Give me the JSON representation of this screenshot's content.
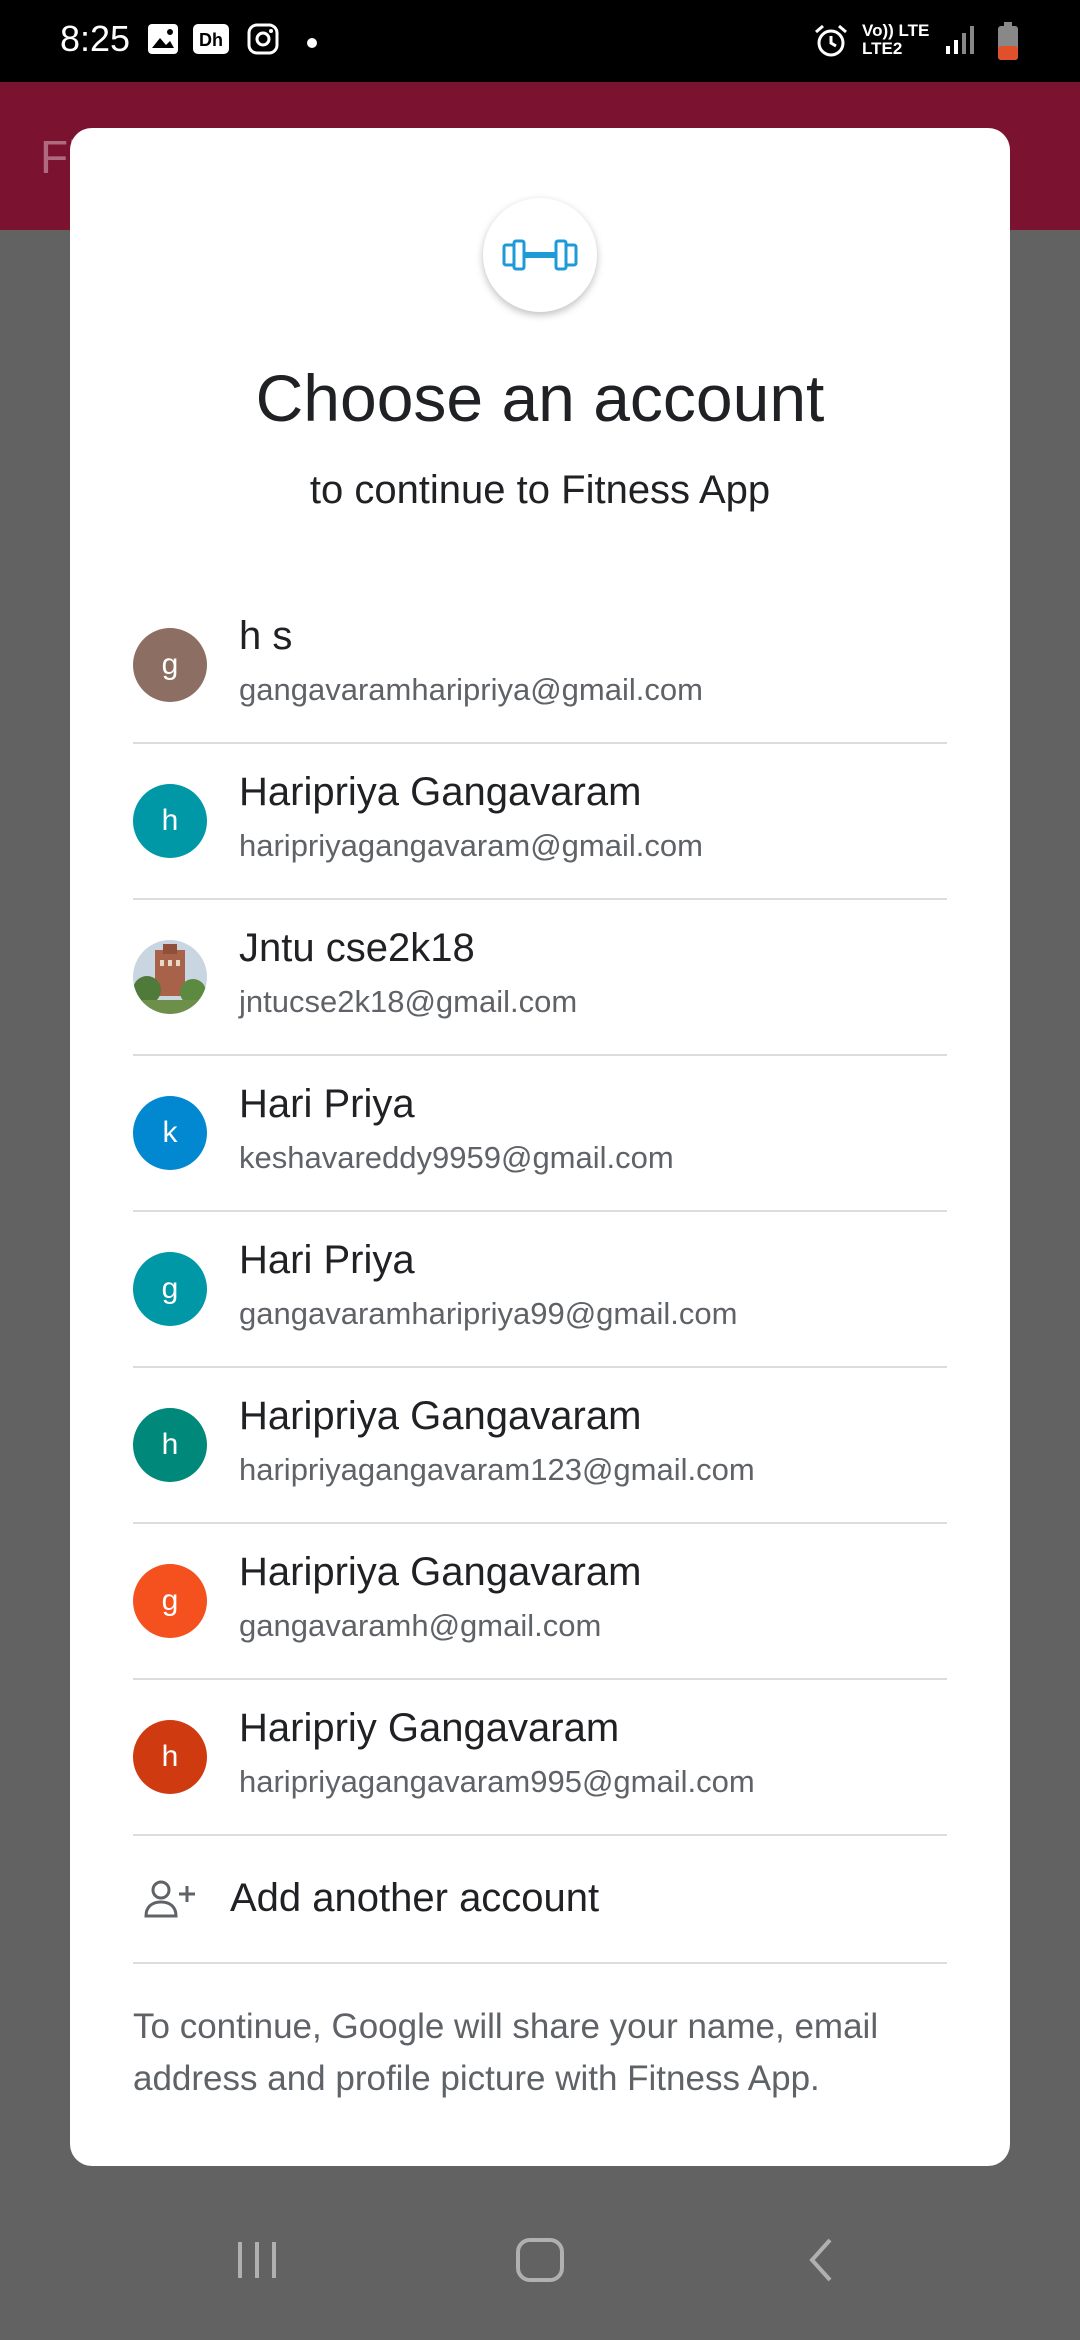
{
  "status_bar": {
    "time": "8:25",
    "icons": [
      "gallery-icon",
      "dh-app-icon",
      "instagram-icon",
      "dot-icon",
      "alarm-icon",
      "volte-lte-icon",
      "signal-icon",
      "battery-icon"
    ],
    "network_top": "Vo)) LTE",
    "network_bottom": "LTE2"
  },
  "app_bar": {
    "title_partial": "Fi"
  },
  "dialog": {
    "title": "Choose an account",
    "subtitle": "to continue to Fitness App",
    "accounts": [
      {
        "initial": "g",
        "name": "h s",
        "email": "gangavaramharipriya@gmail.com",
        "color": "#8d6e63"
      },
      {
        "initial": "h",
        "name": "Haripriya Gangavaram",
        "email": "haripriyagangavaram@gmail.com",
        "color": "#0097a7"
      },
      {
        "initial": "",
        "name": "Jntu cse2k18",
        "email": "jntucse2k18@gmail.com",
        "color": "#8a6f5e"
      },
      {
        "initial": "k",
        "name": "Hari Priya",
        "email": "keshavareddy9959@gmail.com",
        "color": "#0288d1"
      },
      {
        "initial": "g",
        "name": "Hari Priya",
        "email": "gangavaramharipriya99@gmail.com",
        "color": "#0097a7"
      },
      {
        "initial": "h",
        "name": "Haripriya Gangavaram",
        "email": "haripriyagangavaram123@gmail.com",
        "color": "#00897b"
      },
      {
        "initial": "g",
        "name": "Haripriya Gangavaram",
        "email": "gangavaramh@gmail.com",
        "color": "#f4511e"
      },
      {
        "initial": "h",
        "name": "Haripriy Gangavaram",
        "email": "haripriyagangavaram995@gmail.com",
        "color": "#d03a10"
      }
    ],
    "add_account_label": "Add another account",
    "footer_note": "To continue, Google will share your name, email address and profile picture with Fitness App."
  },
  "nav_bar": {
    "buttons": [
      "recents-button",
      "home-button",
      "back-button"
    ]
  }
}
